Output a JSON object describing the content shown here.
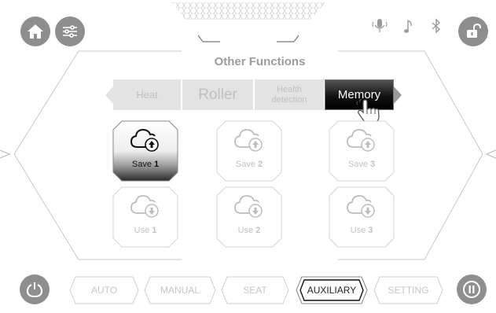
{
  "header": {
    "home_icon": "home-icon",
    "settings_icon": "sliders-icon",
    "status_icons": [
      "microphone-icon",
      "music-note-icon",
      "bluetooth-icon"
    ],
    "lock_icon": "unlocked-padlock-icon"
  },
  "page": {
    "title": "Other Functions"
  },
  "tabs": [
    {
      "label": "Heat",
      "active": false
    },
    {
      "label": "Roller",
      "active": false
    },
    {
      "label": "Health\ndetection",
      "active": false
    },
    {
      "label": "Memory",
      "active": true
    }
  ],
  "memory": {
    "save": [
      {
        "label": "Save",
        "number": "1",
        "active": true
      },
      {
        "label": "Save",
        "number": "2",
        "active": false
      },
      {
        "label": "Save",
        "number": "3",
        "active": false
      }
    ],
    "use": [
      {
        "label": "Use",
        "number": "1",
        "active": false
      },
      {
        "label": "Use",
        "number": "2",
        "active": false
      },
      {
        "label": "Use",
        "number": "3",
        "active": false
      }
    ]
  },
  "bottom_nav": {
    "power_icon": "power-icon",
    "pause_icon": "pause-icon",
    "items": [
      {
        "label": "AUTO",
        "active": false
      },
      {
        "label": "MANUAL",
        "active": false
      },
      {
        "label": "SEAT",
        "active": false
      },
      {
        "label": "AUXILIARY",
        "active": true
      },
      {
        "label": "SETTING",
        "active": false
      }
    ]
  },
  "colors": {
    "icon_gray": "#8e8e8e",
    "inactive_tab": "#e3e3e3",
    "active_tab": "#111111",
    "inactive_text": "#c2c2c2"
  }
}
